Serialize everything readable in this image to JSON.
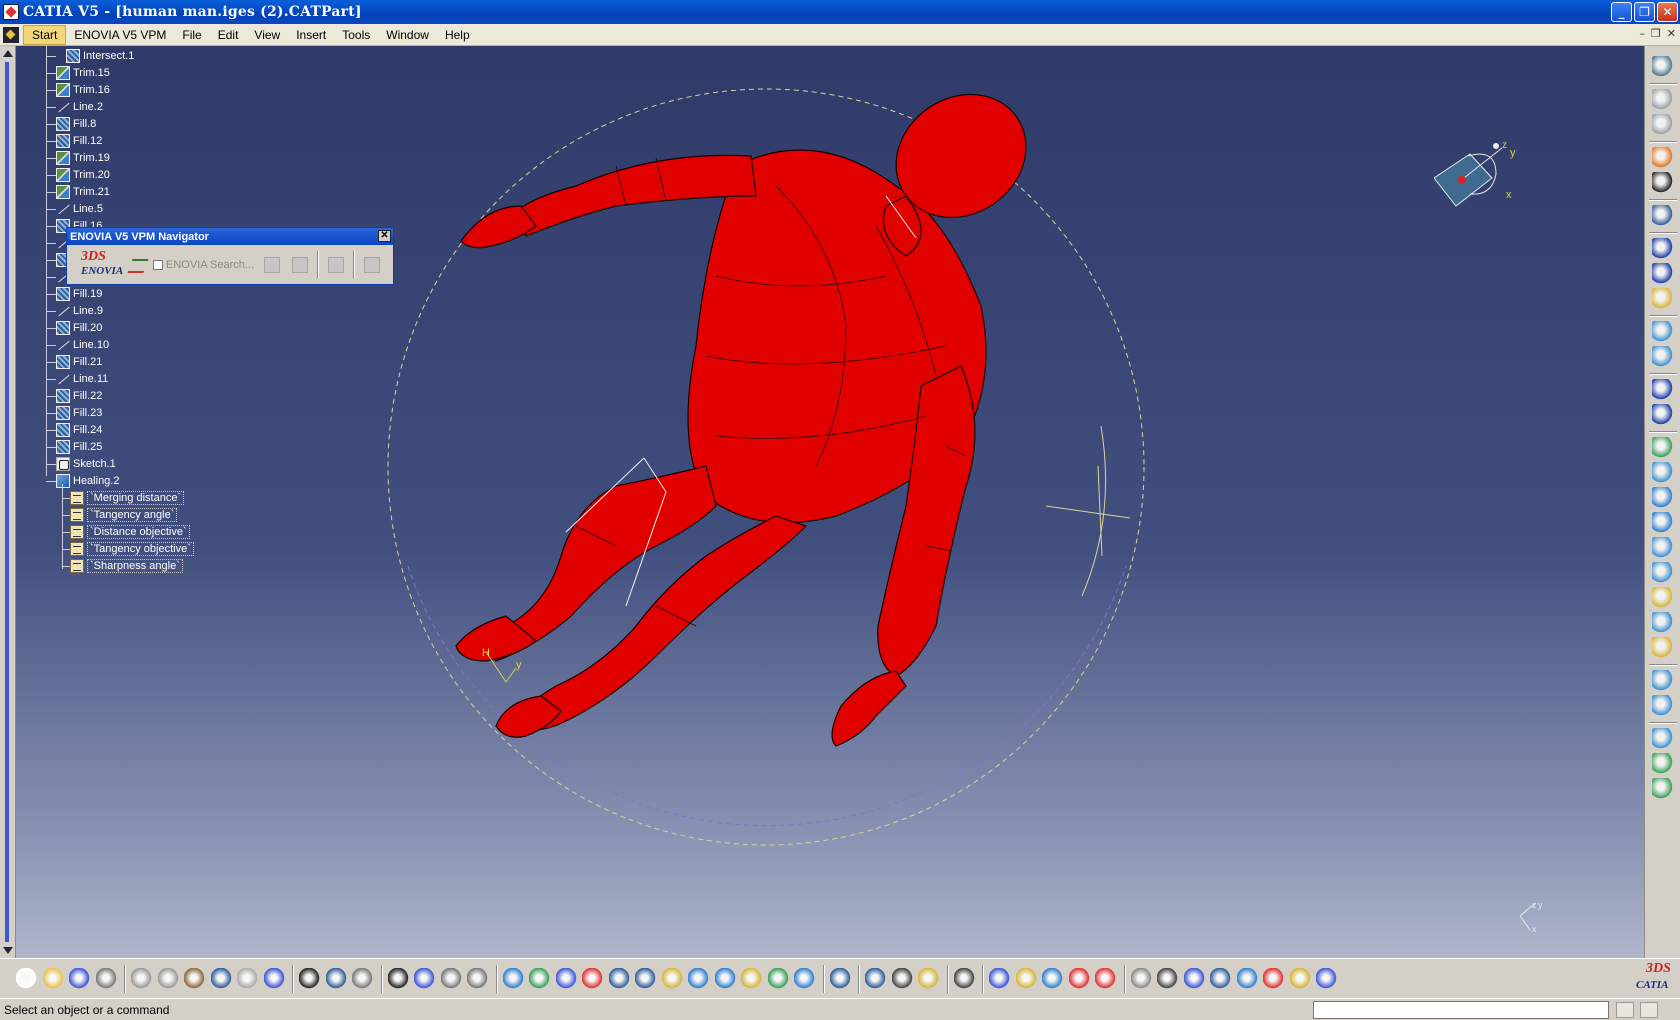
{
  "window": {
    "title": "CATIA V5 - [human man.iges (2).CATPart]",
    "minimize_glyph": "_",
    "restore_glyph": "❐",
    "close_glyph": "✕"
  },
  "menubar": {
    "items": [
      "Start",
      "ENOVIA V5 VPM",
      "File",
      "Edit",
      "View",
      "Insert",
      "Tools",
      "Window",
      "Help"
    ],
    "doc_controls": [
      "–",
      "❐",
      "✕"
    ]
  },
  "tree": {
    "items": [
      {
        "label": "Intersect.1",
        "icon": "intersect-icon"
      },
      {
        "label": "Trim.15",
        "icon": "trim-icon"
      },
      {
        "label": "Trim.16",
        "icon": "trim-icon"
      },
      {
        "label": "Line.2",
        "icon": "line-icon"
      },
      {
        "label": "Fill.8",
        "icon": "fill-icon"
      },
      {
        "label": "Fill.12",
        "icon": "fill-icon"
      },
      {
        "label": "Trim.19",
        "icon": "trim-icon"
      },
      {
        "label": "Trim.20",
        "icon": "trim-icon"
      },
      {
        "label": "Trim.21",
        "icon": "trim-icon"
      },
      {
        "label": "Line.5",
        "icon": "line-icon"
      },
      {
        "label": "Fill.16",
        "icon": "fill-icon"
      },
      {
        "label": "Lin",
        "icon": "line-icon"
      },
      {
        "label": "Fill",
        "icon": "fill-icon"
      },
      {
        "label": "Lin",
        "icon": "line-icon"
      },
      {
        "label": "Fill.19",
        "icon": "fill-icon"
      },
      {
        "label": "Line.9",
        "icon": "line-icon"
      },
      {
        "label": "Fill.20",
        "icon": "fill-icon"
      },
      {
        "label": "Line.10",
        "icon": "line-icon"
      },
      {
        "label": "Fill.21",
        "icon": "fill-icon"
      },
      {
        "label": "Line.11",
        "icon": "line-icon"
      },
      {
        "label": "Fill.22",
        "icon": "fill-icon"
      },
      {
        "label": "Fill.23",
        "icon": "fill-icon"
      },
      {
        "label": "Fill.24",
        "icon": "fill-icon"
      },
      {
        "label": "Fill.25",
        "icon": "fill-icon"
      },
      {
        "label": "Sketch.1",
        "icon": "sketch-icon"
      },
      {
        "label": "Healing.2",
        "icon": "healing-icon"
      }
    ],
    "parameters": [
      "`Merging distance`",
      "`Tangency angle`",
      "`Distance objective`",
      "`Tangency objective`",
      "`Sharpness angle`"
    ]
  },
  "enovia_navigator": {
    "title": "ENOVIA V5 VPM Navigator",
    "logo_text": "ENOVIA",
    "logo_mark": "3DS",
    "search_label": "ENOVIA Search...",
    "close_glyph": "✕"
  },
  "compass": {
    "x_label": "x",
    "y_label": "y",
    "z_label": "z"
  },
  "part_axis": {
    "h_label": "H",
    "v_label": "y"
  },
  "bottom_axis": {
    "y_label": "y",
    "x_label": "x",
    "z_label": "z"
  },
  "bottom_toolbar": {
    "logo_text": "CATIA",
    "logo_mark": "3DS"
  },
  "status": {
    "message": "Select an object or a command",
    "command_input_value": ""
  },
  "colors": {
    "model": "#e00000",
    "background_top": "#2f3a68",
    "background_bottom": "#b0b6cc",
    "titlebar": "#0a46c1"
  }
}
